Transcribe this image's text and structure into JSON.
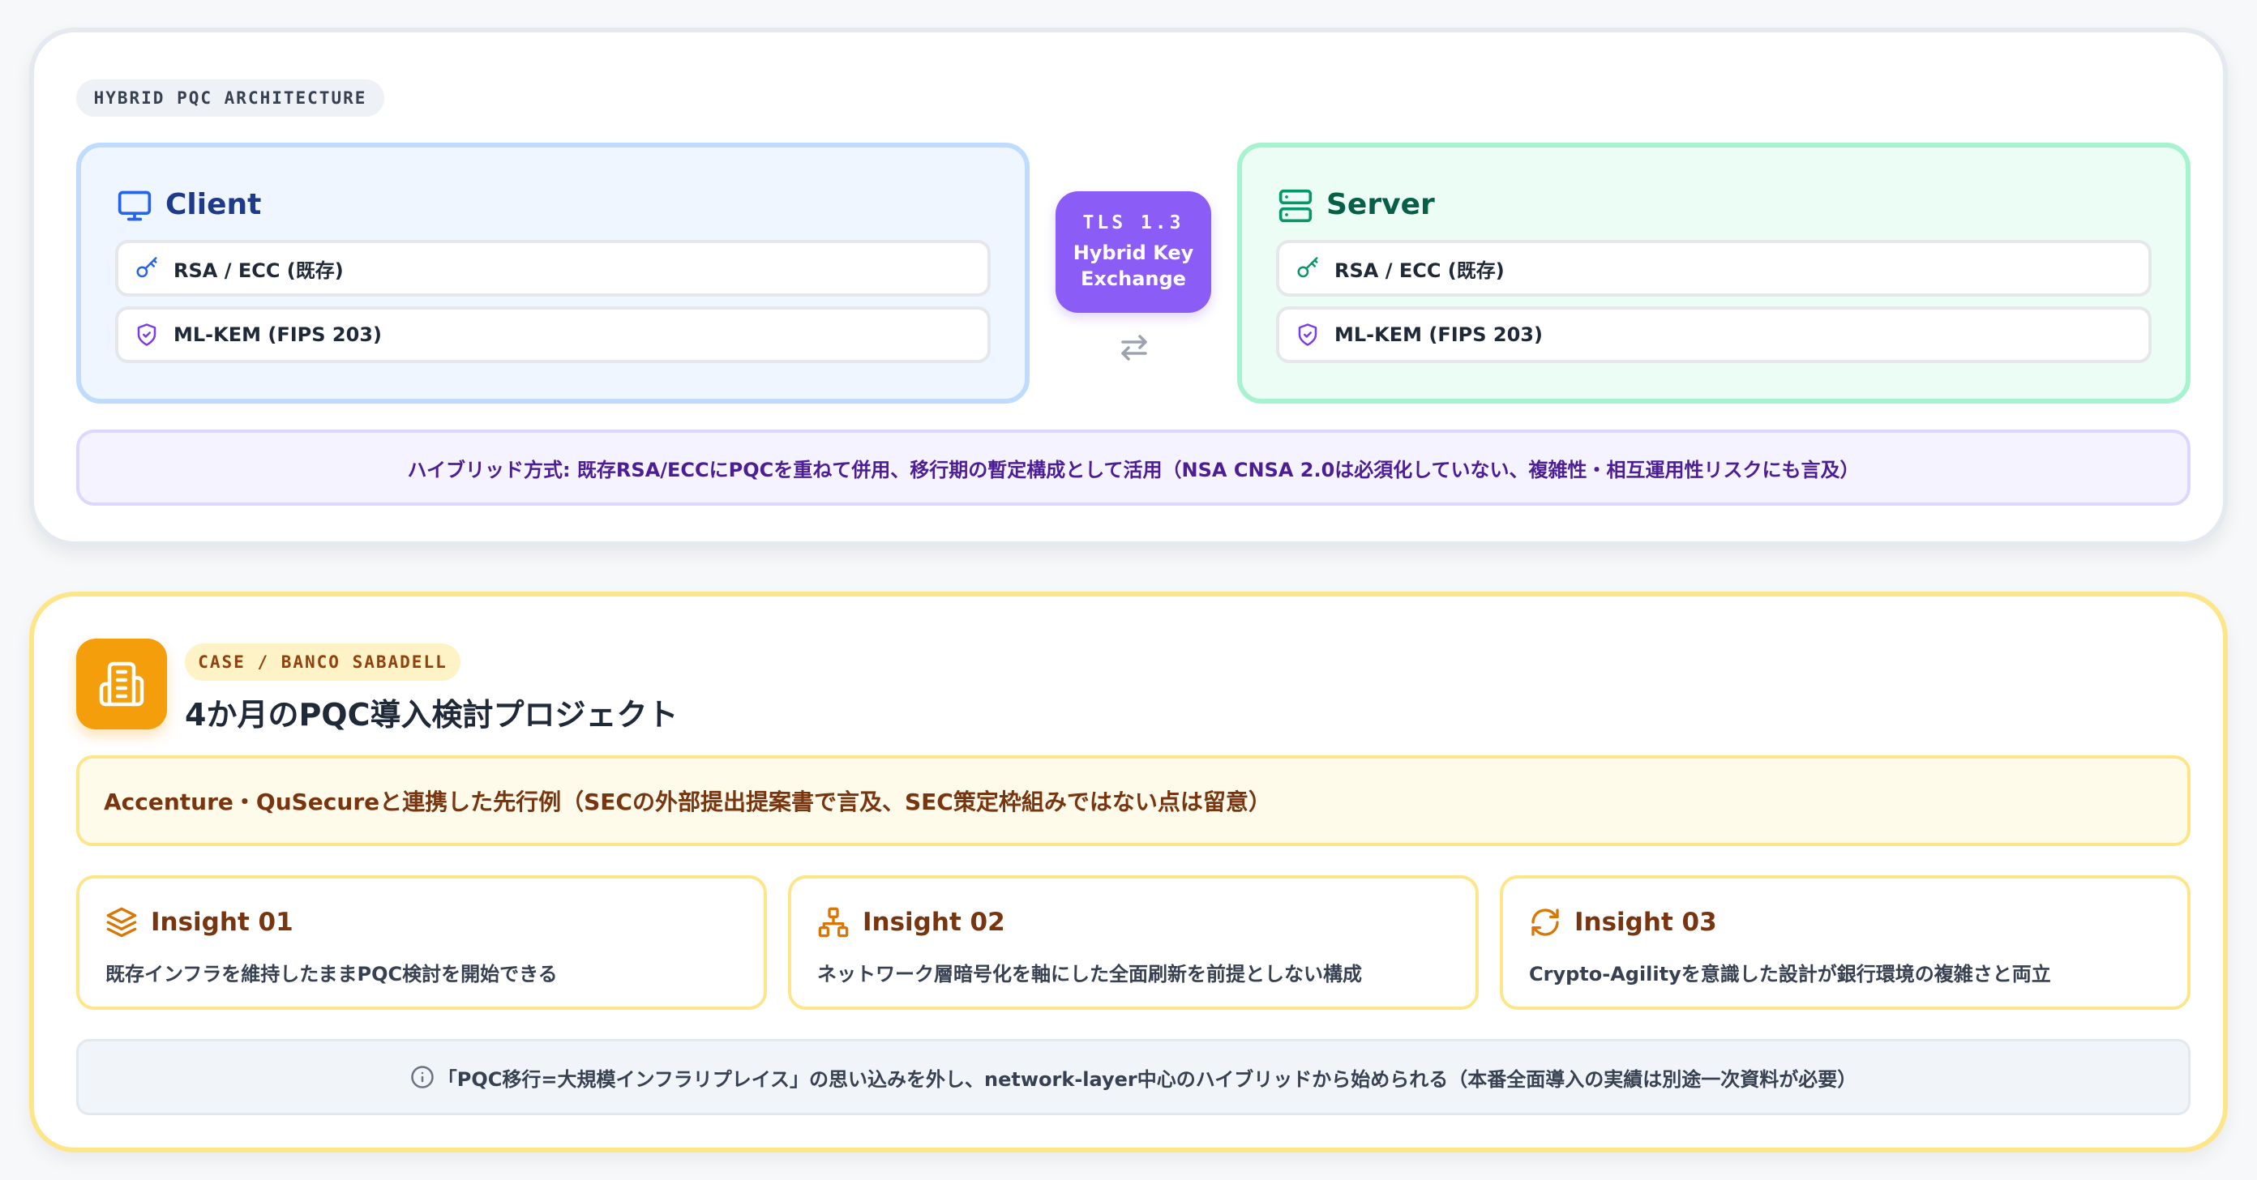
{
  "architecture": {
    "section_label": "HYBRID PQC ARCHITECTURE",
    "client": {
      "title": "Client",
      "rows": [
        {
          "label": "RSA / ECC (既存)",
          "icon": "key-icon"
        },
        {
          "label": "ML-KEM (FIPS 203)",
          "icon": "shield-check-icon"
        }
      ]
    },
    "tls": {
      "top": "TLS 1.3",
      "line1": "Hybrid Key",
      "line2": "Exchange"
    },
    "server": {
      "title": "Server",
      "rows": [
        {
          "label": "RSA / ECC (既存)",
          "icon": "key-icon"
        },
        {
          "label": "ML-KEM (FIPS 203)",
          "icon": "shield-check-icon"
        }
      ]
    },
    "note": "ハイブリッド方式: 既存RSA/ECCにPQCを重ねて併用、移行期の暫定構成として活用（NSA CNSA 2.0は必須化していない、複雑性・相互運用性リスクにも言及）"
  },
  "case": {
    "label": "CASE / BANCO SABADELL",
    "title": "4か月のPQC導入検討プロジェクト",
    "summary": "Accenture・QuSecureと連携した先行例（SECの外部提出提案書で言及、SEC策定枠組みではない点は留意）",
    "insights": [
      {
        "title": "Insight 01",
        "text": "既存インフラを維持したままPQC検討を開始できる",
        "icon": "layers-icon"
      },
      {
        "title": "Insight 02",
        "text": "ネットワーク層暗号化を軸にした全面刷新を前提としない構成",
        "icon": "network-icon"
      },
      {
        "title": "Insight 03",
        "text": "Crypto-Agilityを意識した設計が銀行環境の複雑さと両立",
        "icon": "refresh-icon"
      }
    ],
    "footer": "「PQC移行=大規模インフラリプレイス」の思い込みを外し、network-layer中心のハイブリッドから始められる（本番全面導入の実績は別途一次資料が必要）"
  },
  "colors": {
    "client_accent": "#1e3a8a",
    "server_accent": "#065f46",
    "tls_purple": "#8b5cf6",
    "case_amber": "#f59e0b"
  }
}
